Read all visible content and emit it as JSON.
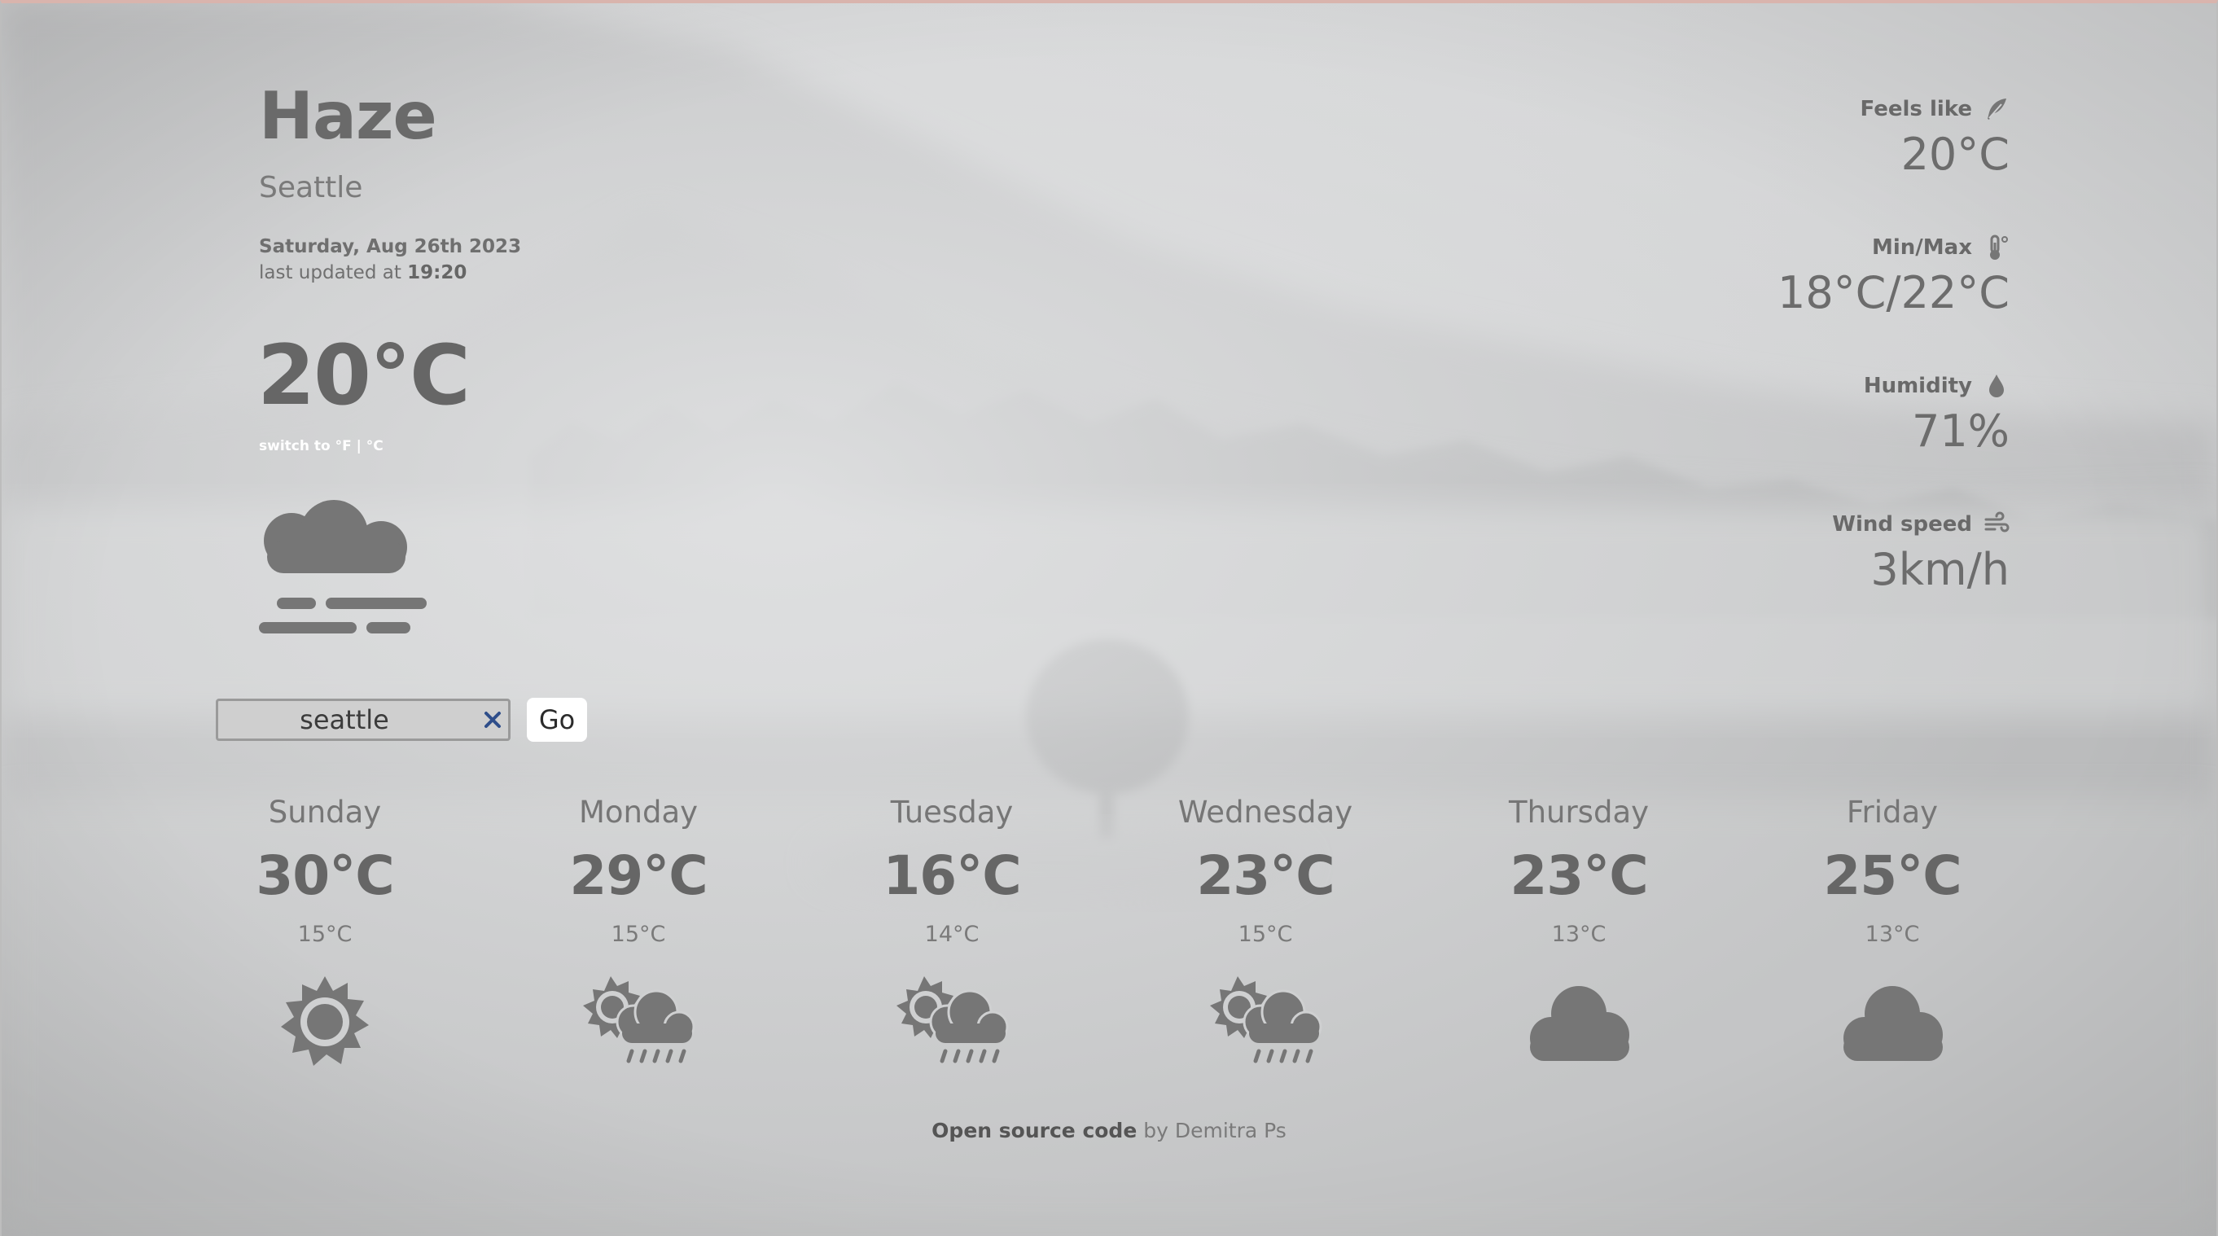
{
  "weather": {
    "condition": "Haze",
    "city": "Seattle",
    "date": "Saturday, Aug 26th 2023",
    "last_updated_prefix": "last updated at",
    "last_updated_time": "19:20",
    "temperature": "20°C",
    "switch_prefix": "switch to",
    "unit_f": "°F",
    "unit_separator": "|",
    "unit_c": "°C",
    "icon": "haze-icon"
  },
  "search": {
    "value": "seattle",
    "go_label": "Go"
  },
  "stats": [
    {
      "label": "Feels like",
      "value": "20°C",
      "icon": "feather-icon"
    },
    {
      "label": "Min/Max",
      "value": "18°C/22°C",
      "icon": "thermometer-icon"
    },
    {
      "label": "Humidity",
      "value": "71%",
      "icon": "droplet-icon"
    },
    {
      "label": "Wind speed",
      "value": "3km/h",
      "icon": "wind-icon"
    }
  ],
  "forecast": [
    {
      "day": "Sunday",
      "high": "30°C",
      "low": "15°C",
      "icon": "sun-icon"
    },
    {
      "day": "Monday",
      "high": "29°C",
      "low": "15°C",
      "icon": "sun-cloud-rain-icon"
    },
    {
      "day": "Tuesday",
      "high": "16°C",
      "low": "14°C",
      "icon": "sun-cloud-rain-icon"
    },
    {
      "day": "Wednesday",
      "high": "23°C",
      "low": "15°C",
      "icon": "sun-cloud-rain-icon"
    },
    {
      "day": "Thursday",
      "high": "23°C",
      "low": "13°C",
      "icon": "cloud-icon"
    },
    {
      "day": "Friday",
      "high": "25°C",
      "low": "13°C",
      "icon": "cloud-icon"
    }
  ],
  "footer": {
    "link_text": "Open source code",
    "by_text": "by Demitra Ps"
  },
  "colors": {
    "text": "#6e6e6e",
    "icon": "#767676",
    "background": "#c9cbcc",
    "switch_text": "#ffffff",
    "clear_x": "#2f4e8a"
  }
}
